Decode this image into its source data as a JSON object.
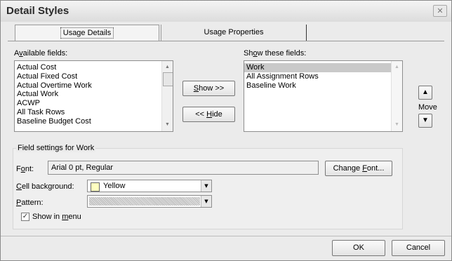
{
  "dialog": {
    "title": "Detail Styles",
    "close_glyph": "✕"
  },
  "tabs": [
    {
      "label": "Usage Details",
      "active": true
    },
    {
      "label": "Usage Properties",
      "active": false
    }
  ],
  "available_fields": {
    "label_pre": "A",
    "label_accel": "v",
    "label_post": "ailable fields:",
    "items": [
      "Actual Cost",
      "Actual Fixed Cost",
      "Actual Overtime Work",
      "Actual Work",
      "ACWP",
      "All Task Rows",
      "Baseline Budget Cost"
    ]
  },
  "show_fields": {
    "label_pre": "Sh",
    "label_accel": "o",
    "label_post": "w these fields:",
    "items": [
      "Work",
      "All Assignment Rows",
      "Baseline Work"
    ],
    "selected_index": 0
  },
  "buttons": {
    "show": {
      "accel": "S",
      "rest": "how >>"
    },
    "hide": {
      "pre": "<< ",
      "accel": "H",
      "rest": "ide"
    },
    "change_font": {
      "pre": "Change ",
      "accel": "F",
      "rest": "ont..."
    },
    "ok": "OK",
    "cancel": "Cancel"
  },
  "move": {
    "label": "Move",
    "up_icon": "arrow-up-icon",
    "down_icon": "arrow-down-icon"
  },
  "field_settings": {
    "heading": "Field settings for Work",
    "font_label_pre": "F",
    "font_label_accel": "o",
    "font_label_post": "nt:",
    "font_value": "Arial 0 pt, Regular",
    "cell_bg_label_accel": "C",
    "cell_bg_label_post": "ell background:",
    "cell_bg_value": "Yellow",
    "cell_bg_color": "#ffffc0",
    "pattern_label_accel": "P",
    "pattern_label_post": "attern:",
    "show_in_menu_pre": "Show in ",
    "show_in_menu_accel": "m",
    "show_in_menu_post": "enu",
    "show_in_menu_checked": true
  },
  "colors": {
    "selection": "#c9c9c9",
    "dialog_bg": "#ebebeb"
  }
}
